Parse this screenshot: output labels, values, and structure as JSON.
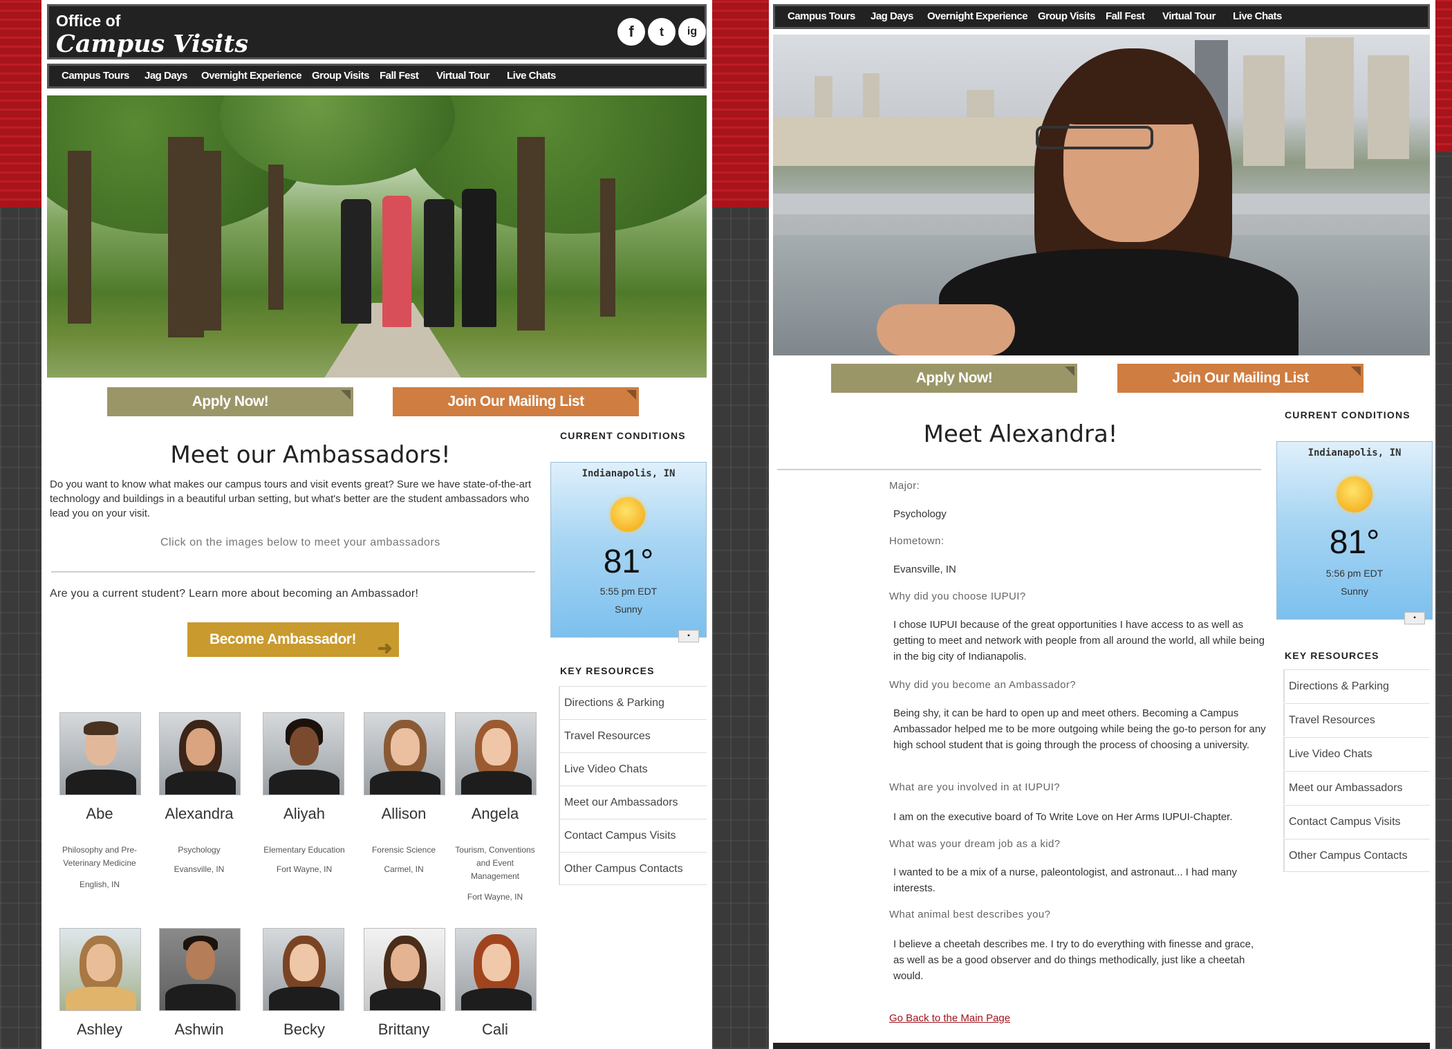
{
  "left": {
    "header": {
      "logo_small": "Office of",
      "logo_big": "Campus Visits",
      "social": [
        "f",
        "t",
        "ig"
      ]
    },
    "nav": [
      "Campus Tours",
      "Jag Days",
      "Overnight Experience",
      "Group Visits",
      "Fall Fest",
      "Virtual Tour",
      "Live Chats"
    ],
    "buttons": {
      "apply": "Apply Now!",
      "mailing": "Join Our Mailing List",
      "become": "Become Ambassador!"
    },
    "main": {
      "title": "Meet our Ambassadors!",
      "intro": "Do you want to know what makes our campus tours and visit events great? Sure we have state-of-the-art technology and buildings in a beautiful urban setting, but what's better are the student ambassadors who lead you on your visit.",
      "click_hint": "Click on the images below to meet your ambassadors",
      "current_student": "Are you a current student? Learn more about becoming an Ambassador!"
    },
    "sidebar": {
      "conditions_title": "CURRENT CONDITIONS",
      "weather": {
        "city": "Indianapolis, IN",
        "temp": "81°",
        "time": "5:55 pm EDT",
        "cond": "Sunny"
      },
      "resources_title": "KEY RESOURCES",
      "resources": [
        "Directions & Parking",
        "Travel Resources",
        "Live Video Chats",
        "Meet our Ambassadors",
        "Contact Campus Visits",
        "Other Campus Contacts"
      ]
    },
    "ambassadors": [
      {
        "name": "Abe",
        "major": "Philosophy and Pre-Veterinary Medicine",
        "hometown": "English, IN"
      },
      {
        "name": "Alexandra",
        "major": "Psychology",
        "hometown": "Evansville, IN"
      },
      {
        "name": "Aliyah",
        "major": "Elementary Education",
        "hometown": "Fort Wayne, IN"
      },
      {
        "name": "Allison",
        "major": "Forensic Science",
        "hometown": "Carmel, IN"
      },
      {
        "name": "Angela",
        "major": "Tourism, Conventions and Event Management",
        "hometown": "Fort Wayne, IN"
      },
      {
        "name": "Ashley"
      },
      {
        "name": "Ashwin"
      },
      {
        "name": "Becky"
      },
      {
        "name": "Brittany"
      },
      {
        "name": "Cali"
      }
    ]
  },
  "right": {
    "nav": [
      "Campus Tours",
      "Jag Days",
      "Overnight Experience",
      "Group Visits",
      "Fall Fest",
      "Virtual Tour",
      "Live Chats"
    ],
    "buttons": {
      "apply": "Apply Now!",
      "mailing": "Join Our Mailing List"
    },
    "title": "Meet Alexandra!",
    "profile": [
      {
        "q": "Major:",
        "a": "Psychology"
      },
      {
        "q": "Hometown:",
        "a": "Evansville, IN"
      },
      {
        "q": "Why did you choose IUPUI?",
        "a": "I chose IUPUI because of the great opportunities I have access to as well as getting to meet and network with people from all around the world, all while being in the big city of Indianapolis."
      },
      {
        "q": "Why did you become an Ambassador?",
        "a": "Being shy, it can be hard to open up and meet others. Becoming a Campus Ambassador helped me to be more outgoing while being the go-to person for any high school student that is going through the process of choosing a university."
      },
      {
        "q": "What are you involved in at IUPUI?",
        "a": "I am on the executive board of To Write Love on Her Arms IUPUI-Chapter."
      },
      {
        "q": "What was your dream job as a kid?",
        "a": "I wanted to be a mix of a nurse, paleontologist, and astronaut... I had many interests."
      },
      {
        "q": "What animal best describes you?",
        "a": "I believe a cheetah describes me. I try to do everything with finesse and grace, as well as be a good observer and do things methodically, just like a cheetah would."
      }
    ],
    "back_link": "Go Back to the Main Page",
    "sidebar": {
      "conditions_title": "CURRENT CONDITIONS",
      "weather": {
        "city": "Indianapolis, IN",
        "temp": "81°",
        "time": "5:56 pm EDT",
        "cond": "Sunny"
      },
      "resources_title": "KEY RESOURCES",
      "resources": [
        "Directions & Parking",
        "Travel Resources",
        "Live Video Chats",
        "Meet our Ambassadors",
        "Contact Campus Visits",
        "Other Campus Contacts"
      ]
    }
  },
  "colors": {
    "brand_red": "#a8141c",
    "apply": "#9b9668",
    "mailing": "#cf7d41",
    "become": "#c99a2e"
  }
}
